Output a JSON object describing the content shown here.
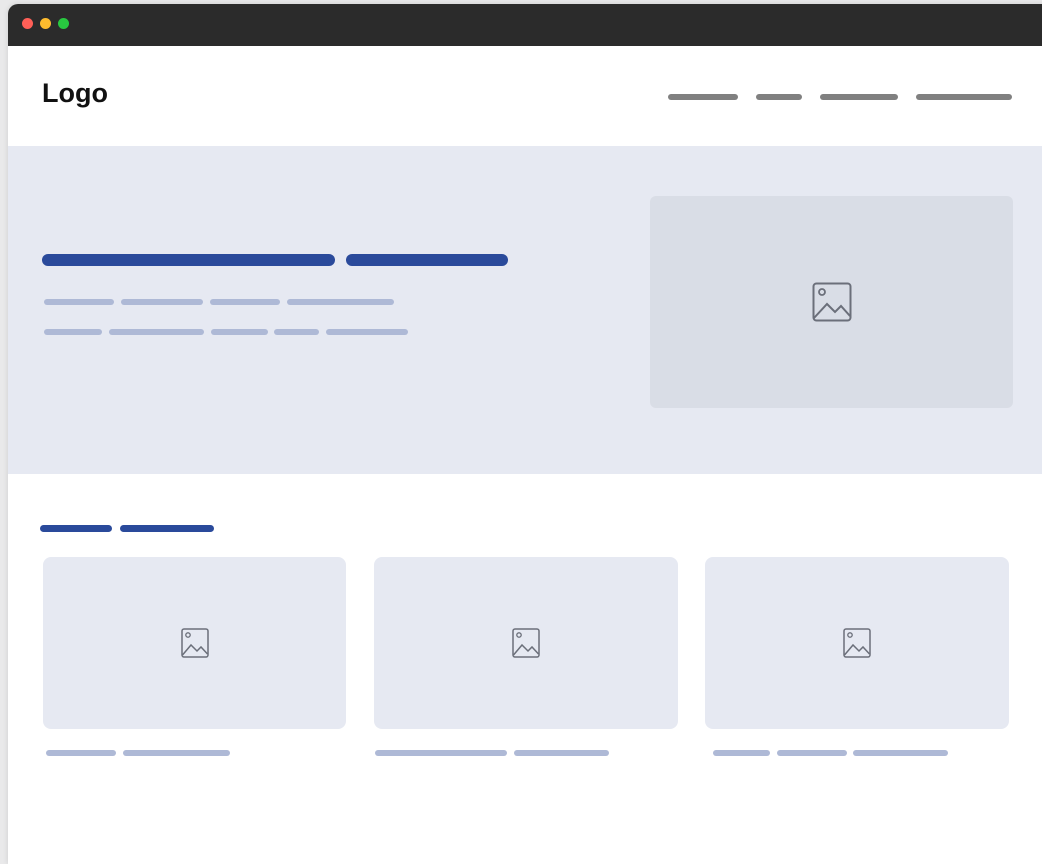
{
  "header": {
    "logo_text": "Logo"
  },
  "colors": {
    "titlebar": "#2b2b2b",
    "traffic_red": "#ff5f57",
    "traffic_yellow": "#febc2e",
    "traffic_green": "#28c840",
    "nav_placeholder": "#808080",
    "hero_background": "#e6e9f2",
    "hero_image_background": "#d9dde6",
    "card_background": "#e6e9f2",
    "heading_placeholder": "#2a4a9b",
    "text_placeholder": "#aeb9d6",
    "icon_stroke": "#6b6f7a"
  },
  "icons": {
    "image": "image-placeholder-icon"
  }
}
